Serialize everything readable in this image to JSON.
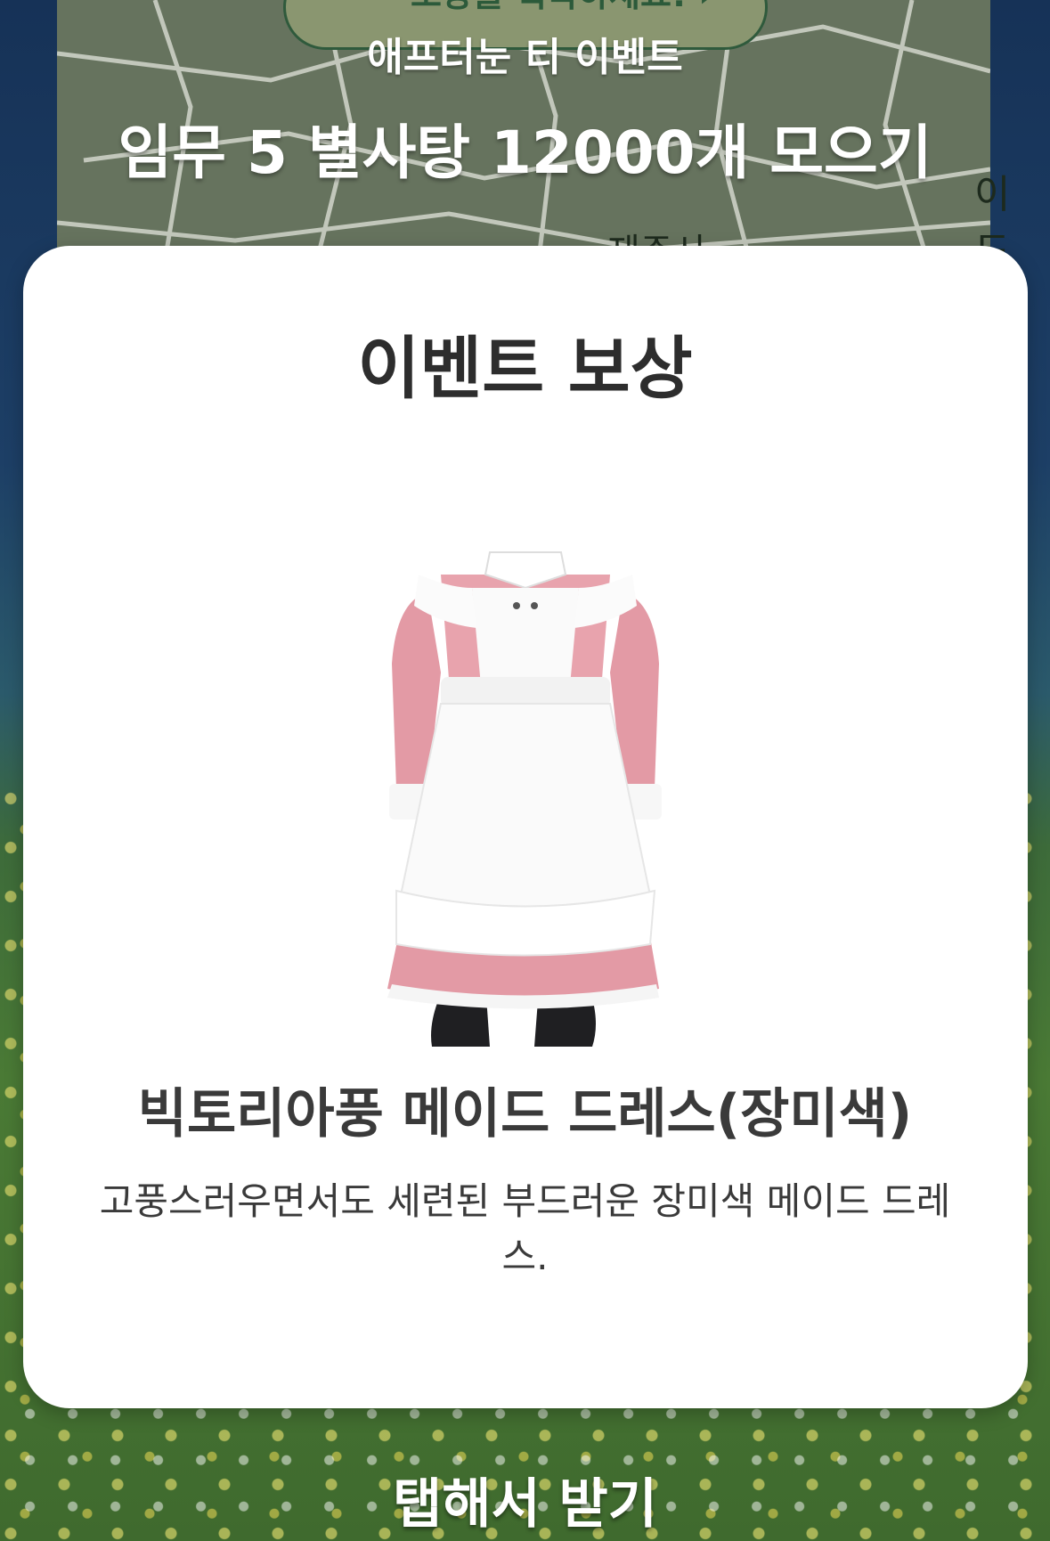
{
  "background": {
    "banner_text": "보상을 획득하세요!",
    "banner_arrow": "›",
    "event_name": "애프터눈 티 이벤트",
    "mission_text": "임무 5 별사탕 12000개 모으기",
    "map_labels": [
      "이도",
      "제주시"
    ]
  },
  "reward_card": {
    "title": "이벤트 보상",
    "item_icon": "maid-dress-icon",
    "item_name": "빅토리아풍 메이드 드레스(장미색)",
    "item_description": "고풍스러우면서도 세련된 부드러운 장미색 메이드 드레스."
  },
  "footer": {
    "tap_hint": "탭해서 받기"
  },
  "colors": {
    "card_bg": "#ffffff",
    "text_dark": "#2d2d2d",
    "dress_pink": "#e39aa5",
    "apron_white": "#fafafa"
  }
}
